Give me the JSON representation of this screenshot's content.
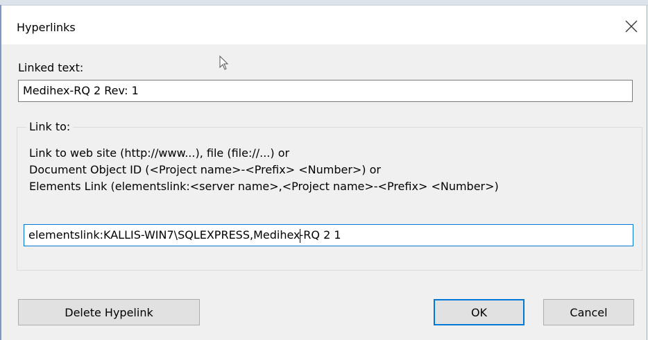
{
  "dialog": {
    "title": "Hyperlinks",
    "close_icon": "close-icon"
  },
  "linked_text": {
    "label": "Linked text:",
    "value": "Medihex-RQ 2 Rev: 1"
  },
  "link_to": {
    "group_label": "Link to:",
    "hint_lines": [
      "Link to web site (http://www...), file (file://...) or",
      "Document Object ID (<Project name>-<Prefix> <Number>) or",
      "Elements Link (elementslink:<server name>,<Project name>-<Prefix> <Number>)"
    ],
    "value_before_caret": "elementslink:KALLIS-WIN7\\SQLEXPRESS,Medihex",
    "value_after_caret": "-RQ 2 1"
  },
  "buttons": {
    "delete_label": "Delete Hypelink",
    "ok_label": "OK",
    "cancel_label": "Cancel"
  },
  "colors": {
    "focus_border": "#0078d7",
    "dialog_bg": "#f0f0f0"
  }
}
